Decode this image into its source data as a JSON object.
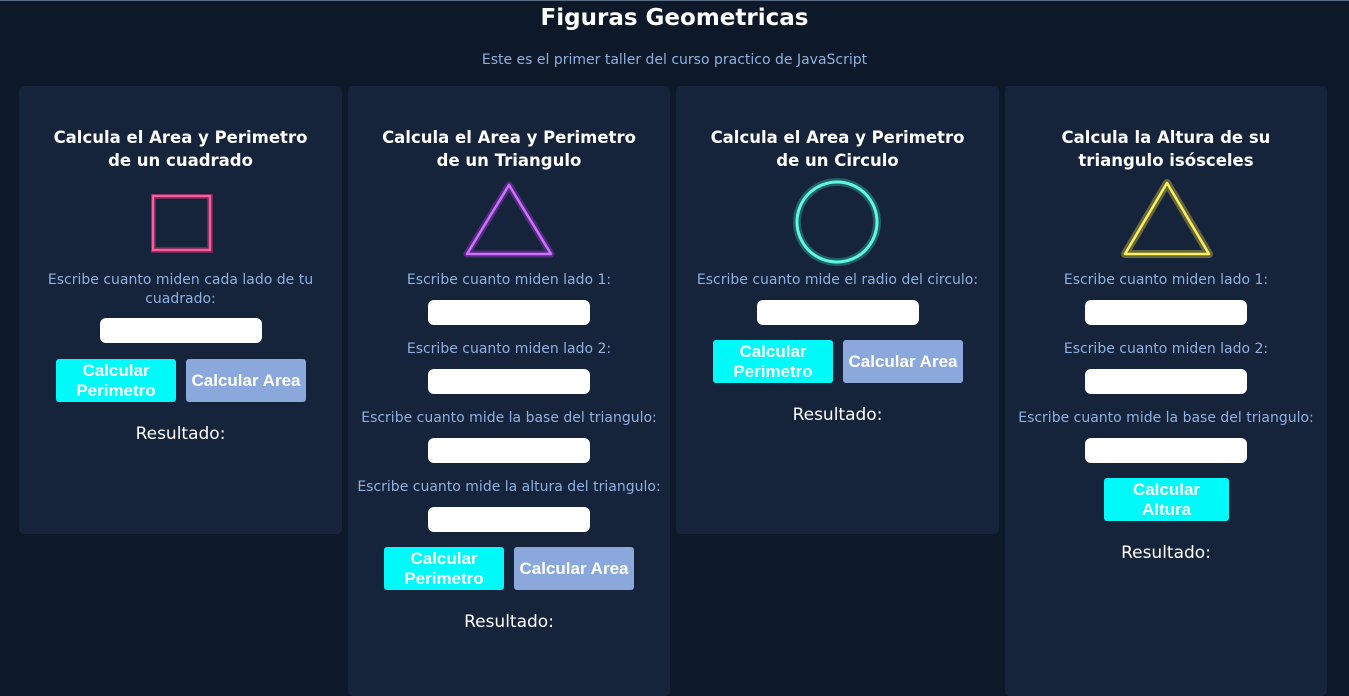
{
  "page": {
    "title": "Figuras Geometricas",
    "subtitle": "Este es el primer taller del curso practico de JavaScript"
  },
  "cards": [
    {
      "title_line1": "Calcula el Area y Perimetro",
      "title_line2": "de un cuadrado",
      "shape": "square-icon",
      "color": "#ff3c8c",
      "label_line1": "Escribe cuanto miden cada lado de tu",
      "label_line2": "cuadrado:",
      "btn_perimetro_line1": "Calcular",
      "btn_perimetro_line2": "Perimetro",
      "btn_area": "Calcular Area",
      "result": "Resultado:"
    },
    {
      "title_line1": "Calcula el Area y Perimetro",
      "title_line2": "de un Triangulo",
      "shape": "triangle-icon",
      "color": "#c040ff",
      "labels": [
        "Escribe cuanto miden lado 1:",
        "Escribe cuanto miden lado 2:",
        "Escribe cuanto mide la base del triangulo:",
        "Escribe cuanto mide la altura del triangulo:"
      ],
      "btn_perimetro_line1": "Calcular",
      "btn_perimetro_line2": "Perimetro",
      "btn_area": "Calcular Area",
      "result": "Resultado:"
    },
    {
      "title_line1": "Calcula el Area y Perimetro",
      "title_line2": "de un Circulo",
      "shape": "circle-icon",
      "color": "#40f0d0",
      "label": "Escribe cuanto mide el radio del circulo:",
      "btn_perimetro_line1": "Calcular",
      "btn_perimetro_line2": "Perimetro",
      "btn_area": "Calcular Area",
      "result": "Resultado:"
    },
    {
      "title_line1": "Calcula la Altura de su",
      "title_line2": "triangulo isósceles",
      "shape": "triangle-icon",
      "color": "#ffe840",
      "labels": [
        "Escribe cuanto miden lado 1:",
        "Escribe cuanto miden lado 2:",
        "Escribe cuanto mide la base del triangulo:"
      ],
      "btn_altura_line1": "Calcular",
      "btn_altura_line2": "Altura",
      "result": "Resultado:"
    }
  ]
}
